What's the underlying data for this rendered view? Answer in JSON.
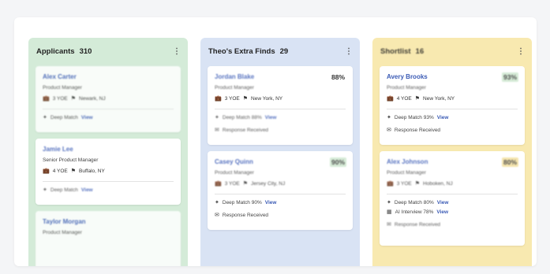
{
  "columns": [
    {
      "title": "Applicants",
      "count": "310",
      "cards": [
        {
          "name": "Alex Carter",
          "title": "Product Manager",
          "yoe": "3 YOE",
          "location": "Newark, NJ",
          "deep_match_label": "Deep Match",
          "deep_match_link": "View",
          "score": ""
        },
        {
          "name": "Jamie Lee",
          "title": "Senior Product Manager",
          "yoe": "4 YOE",
          "location": "Buffalo, NY",
          "deep_match_label": "Deep Match",
          "deep_match_link": "View",
          "score": ""
        },
        {
          "name": "Taylor Morgan",
          "title": "Product Manager",
          "yoe": "",
          "location": "",
          "deep_match_label": "",
          "deep_match_link": "",
          "score": ""
        }
      ]
    },
    {
      "title": "Theo's Extra Finds",
      "count": "29",
      "cards": [
        {
          "name": "Jordan Blake",
          "title": "Product Manager",
          "yoe": "3 YOE",
          "location": "New York, NY",
          "deep_match_label": "Deep Match 88%",
          "deep_match_link": "View",
          "response": "Response Received",
          "score": "88%"
        },
        {
          "name": "Casey Quinn",
          "title": "Product Manager",
          "yoe": "3 YOE",
          "location": "Jersey City, NJ",
          "deep_match_label": "Deep Match 90%",
          "deep_match_link": "View",
          "response": "Response Received",
          "score": "90%"
        }
      ]
    },
    {
      "title": "Shortlist",
      "count": "16",
      "cards": [
        {
          "name": "Avery Brooks",
          "title": "Product Manager",
          "yoe": "4 YOE",
          "location": "New York, NY",
          "deep_match_label": "Deep Match 93%",
          "deep_match_link": "View",
          "response": "Response Received",
          "score": "93%"
        },
        {
          "name": "Alex Johnson",
          "title": "Product Manager",
          "yoe": "3 YOE",
          "location": "Hoboken, NJ",
          "deep_match_label": "Deep Match 80%",
          "deep_match_link": "View",
          "interview_label": "AI Interview 78%",
          "interview_link": "View",
          "response": "Response Received",
          "score": "80%"
        }
      ]
    }
  ],
  "colors": {
    "green": "#d4ebd8",
    "blue": "#d9e3f4",
    "yellow": "#f8e9b0",
    "link": "#3b5bb5",
    "score_green": "#cfe8d0",
    "score_yellow": "#f3e0a0"
  },
  "icons": {
    "menu": "kebab-icon",
    "briefcase": "briefcase-icon",
    "location": "location-pin-icon",
    "sparkle": "sparkle-icon",
    "mail": "mail-icon",
    "interview": "interview-icon"
  }
}
